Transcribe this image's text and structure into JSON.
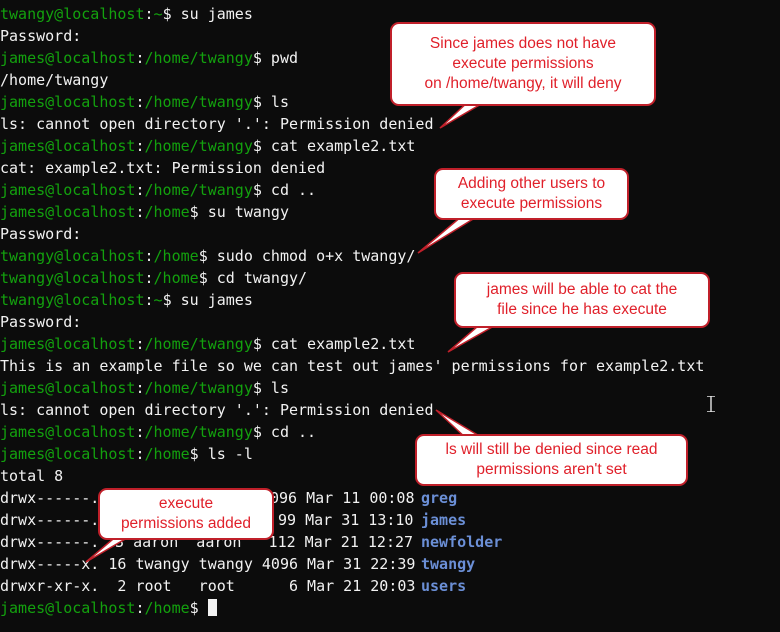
{
  "terminal": {
    "lines": [
      {
        "user": "twangy@localhost",
        "path": "~",
        "cmd": " su james"
      },
      {
        "text": "Password:"
      },
      {
        "user": "james@localhost",
        "path": "/home/twangy",
        "cmd": " pwd"
      },
      {
        "text": "/home/twangy"
      },
      {
        "user": "james@localhost",
        "path": "/home/twangy",
        "cmd": " ls"
      },
      {
        "text": "ls: cannot open directory '.': Permission denied"
      },
      {
        "user": "james@localhost",
        "path": "/home/twangy",
        "cmd": " cat example2.txt"
      },
      {
        "text": "cat: example2.txt: Permission denied"
      },
      {
        "user": "james@localhost",
        "path": "/home/twangy",
        "cmd": " cd .."
      },
      {
        "user": "james@localhost",
        "path": "/home",
        "cmd": " su twangy"
      },
      {
        "text": "Password:"
      },
      {
        "user": "twangy@localhost",
        "path": "/home",
        "cmd": " sudo chmod o+x twangy/"
      },
      {
        "user": "twangy@localhost",
        "path": "/home",
        "cmd": " cd twangy/"
      },
      {
        "user": "twangy@localhost",
        "path": "~",
        "cmd": " su james"
      },
      {
        "text": "Password:"
      },
      {
        "user": "james@localhost",
        "path": "/home/twangy",
        "cmd": " cat example2.txt"
      },
      {
        "text": "This is an example file so we can test out james' permissions for example2.txt"
      },
      {
        "user": "james@localhost",
        "path": "/home/twangy",
        "cmd": " ls"
      },
      {
        "text": "ls: cannot open directory '.': Permission denied"
      },
      {
        "user": "james@localhost",
        "path": "/home/twangy",
        "cmd": " cd .."
      },
      {
        "user": "james@localhost",
        "path": "/home",
        "cmd": " ls -l"
      },
      {
        "text": "total 8"
      },
      {
        "text": "drwx------. 99 Mar 11 00:08 ",
        "dir": "greg",
        "visible_part": "drwx------.",
        "tail": "096 Mar 11 00:08 "
      },
      {
        "text": "drwx------.",
        "tail": "99 Mar 31 13:10 ",
        "dir": "james"
      },
      {
        "text": "drwx------.",
        "mid": " 3 aaron  aaron   112 Mar 21 12:27 ",
        "dir": "newfolder"
      },
      {
        "text": "drwx-----x. 16 twangy twangy 4096 Mar 31 22:39 ",
        "dir": "twangy"
      },
      {
        "text": "drwxr-xr-x.  2 root   root      6 Mar 21 20:03 ",
        "dir": "users"
      },
      {
        "user": "james@localhost",
        "path": "/home",
        "cmd": " ",
        "cursor": true
      }
    ]
  },
  "callouts": {
    "c1": "Since james does not have\nexecute permissions\non /home/twangy, it will deny",
    "c2": "Adding other users to\nexecute permissions",
    "c3": "james will be able to cat the\nfile since he has execute",
    "c4": "ls will still be denied since read\npermissions aren't set",
    "c5": "execute\npermissions added"
  },
  "colors": {
    "prompt": "#13a10e",
    "text": "#f2f2f2",
    "directory": "#6b8fd6",
    "callout_border": "#c0202a",
    "callout_text": "#e0202a"
  }
}
